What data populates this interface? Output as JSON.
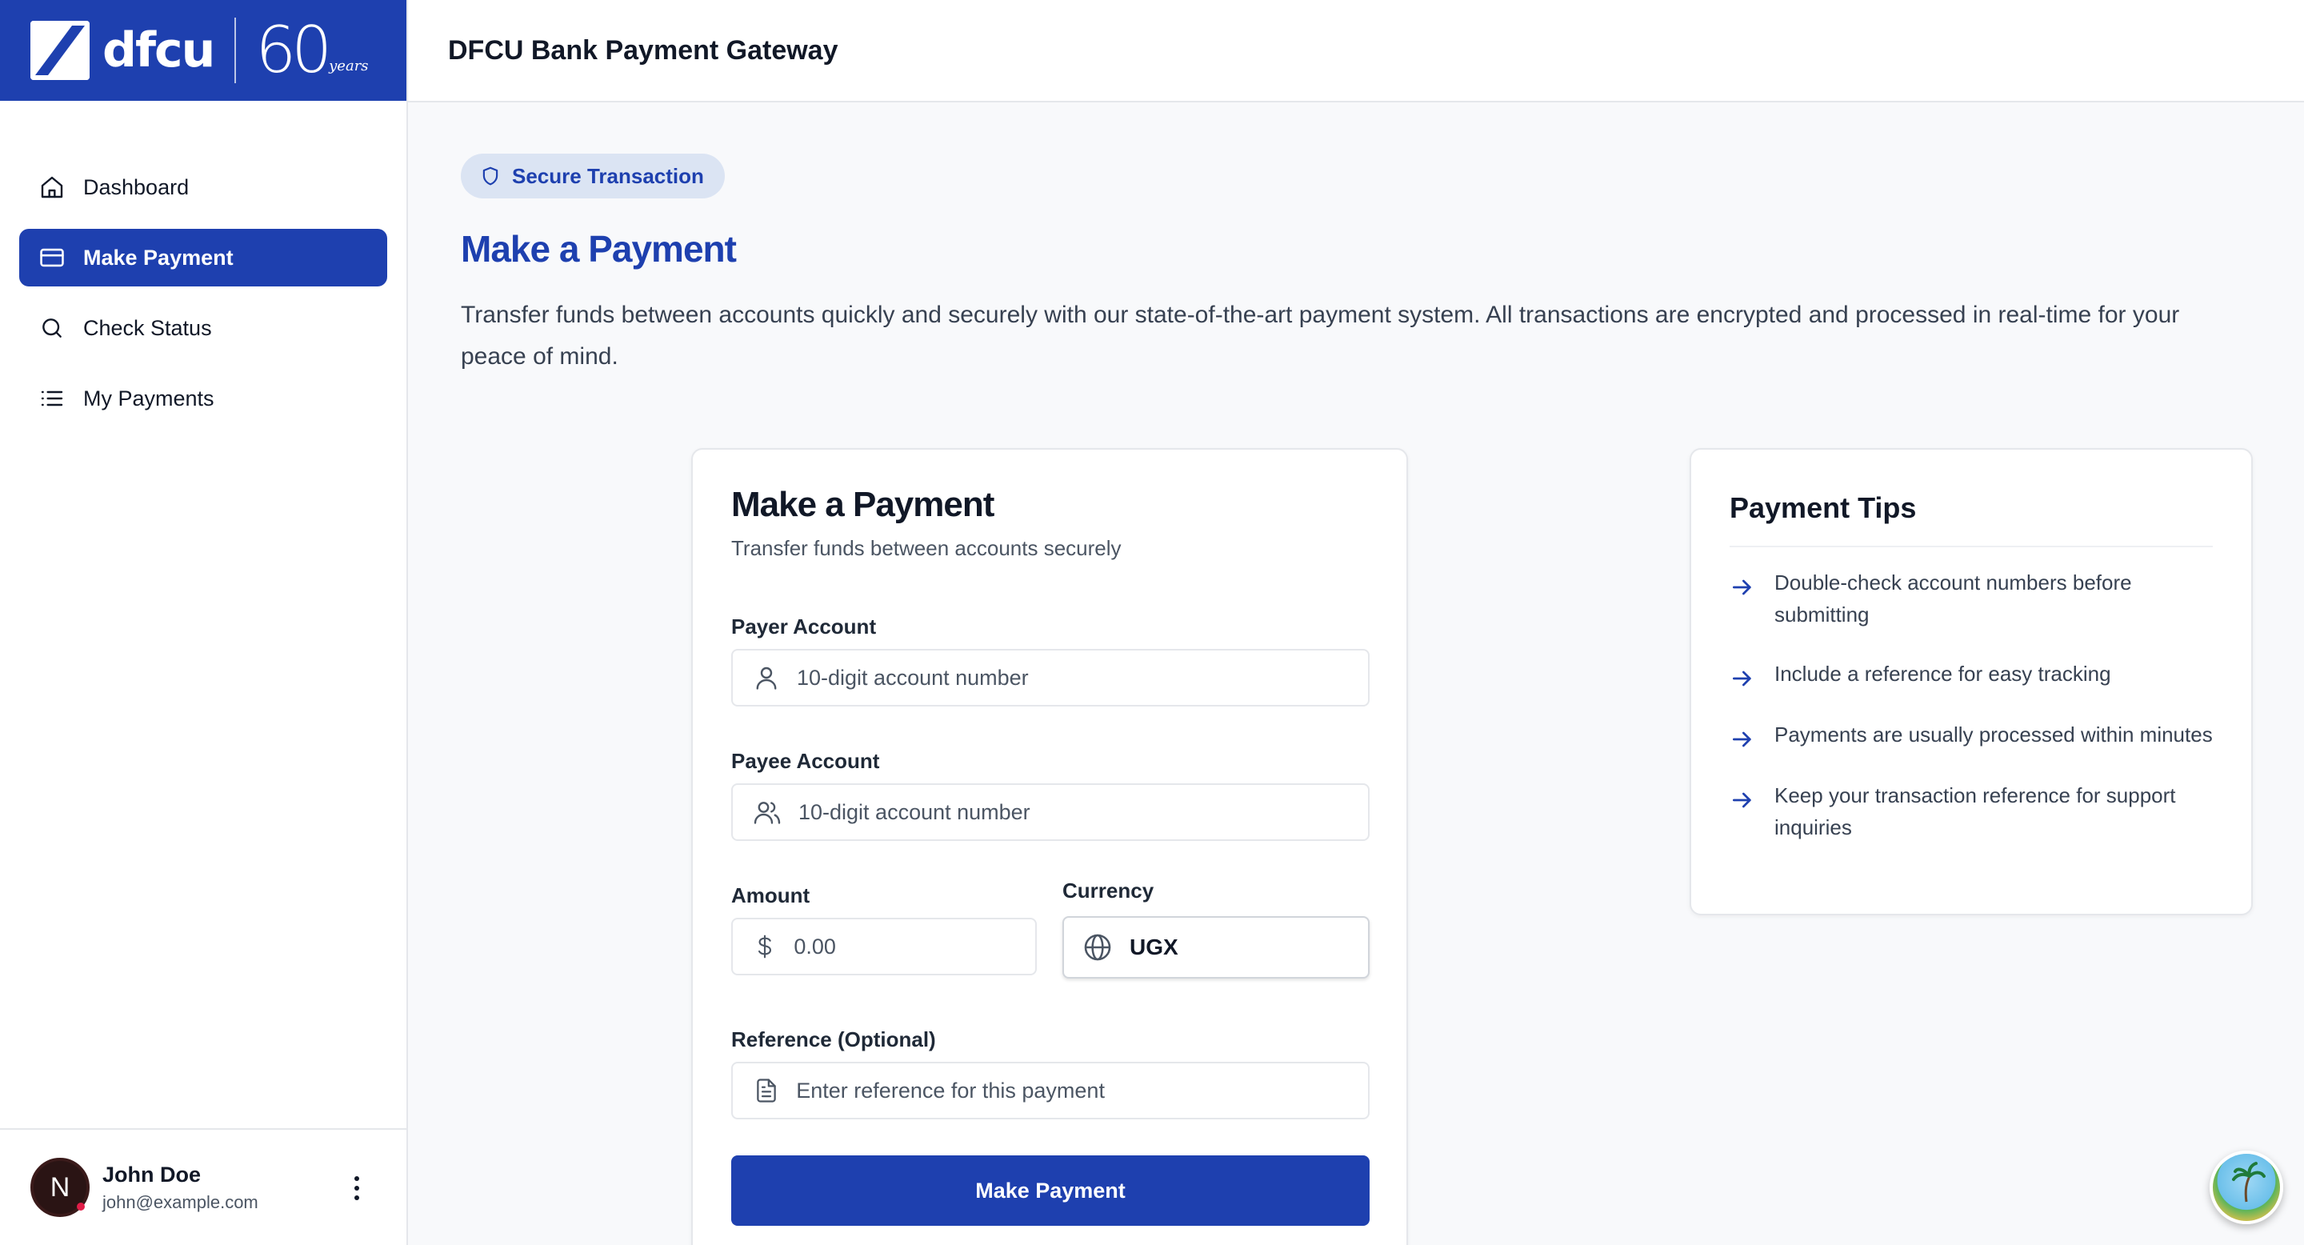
{
  "brand": {
    "name": "dfcu",
    "anniversary_number": "60",
    "anniversary_text": "years"
  },
  "header": {
    "title": "DFCU Bank Payment Gateway"
  },
  "sidebar": {
    "items": [
      {
        "label": "Dashboard",
        "icon": "home-icon",
        "active": false
      },
      {
        "label": "Make Payment",
        "icon": "credit-card-icon",
        "active": true
      },
      {
        "label": "Check Status",
        "icon": "search-icon",
        "active": false
      },
      {
        "label": "My Payments",
        "icon": "list-icon",
        "active": false
      }
    ]
  },
  "user": {
    "initial": "N",
    "name": "John Doe",
    "email": "john@example.com"
  },
  "page": {
    "badge": "Secure Transaction",
    "title": "Make a Payment",
    "description": "Transfer funds between accounts quickly and securely with our state-of-the-art payment system. All transactions are encrypted and processed in real-time for your peace of mind."
  },
  "form": {
    "title": "Make a Payment",
    "subtitle": "Transfer funds between accounts securely",
    "payer": {
      "label": "Payer Account",
      "placeholder": "10-digit account number"
    },
    "payee": {
      "label": "Payee Account",
      "placeholder": "10-digit account number"
    },
    "amount": {
      "label": "Amount",
      "placeholder": "0.00"
    },
    "currency": {
      "label": "Currency",
      "value": "UGX"
    },
    "reference": {
      "label": "Reference (Optional)",
      "placeholder": "Enter reference for this payment"
    },
    "submit_label": "Make Payment"
  },
  "tips": {
    "title": "Payment Tips",
    "items": [
      "Double-check account numbers before submitting",
      "Include a reference for easy tracking",
      "Payments are usually processed within minutes",
      "Keep your transaction reference for support inquiries"
    ]
  },
  "colors": {
    "primary": "#1e40af",
    "badge_bg": "#dbe4f3",
    "page_bg": "#f8f9fb"
  }
}
